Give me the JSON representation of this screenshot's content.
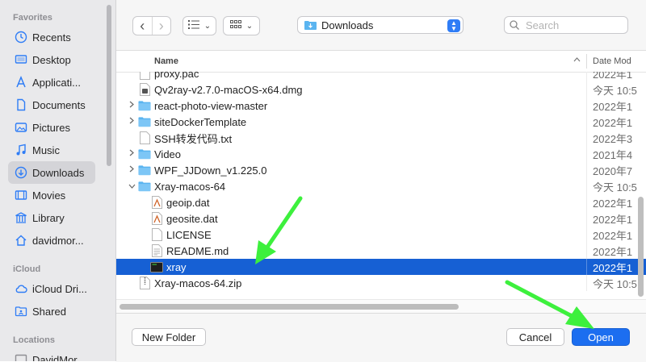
{
  "sidebar": {
    "favorites_label": "Favorites",
    "favorites": [
      {
        "label": "Recents",
        "icon": "clock-icon"
      },
      {
        "label": "Desktop",
        "icon": "desktop-icon"
      },
      {
        "label": "Applicati...",
        "icon": "applications-icon"
      },
      {
        "label": "Documents",
        "icon": "document-icon"
      },
      {
        "label": "Pictures",
        "icon": "photo-icon"
      },
      {
        "label": "Music",
        "icon": "music-note-icon"
      },
      {
        "label": "Downloads",
        "icon": "download-icon",
        "active": true
      },
      {
        "label": "Movies",
        "icon": "film-icon"
      },
      {
        "label": "Library",
        "icon": "library-icon"
      },
      {
        "label": "davidmor...",
        "icon": "home-icon"
      }
    ],
    "icloud_label": "iCloud",
    "icloud": [
      {
        "label": "iCloud Dri...",
        "icon": "cloud-icon"
      },
      {
        "label": "Shared",
        "icon": "shared-folder-icon"
      }
    ],
    "locations_label": "Locations",
    "locations": [
      {
        "label": "DavidMor...",
        "icon": "computer-icon"
      }
    ]
  },
  "toolbar": {
    "back_glyph": "‹",
    "forward_glyph": "›",
    "location": "Downloads",
    "search_placeholder": "Search"
  },
  "columns": {
    "name": "Name",
    "date": "Date Mod"
  },
  "files": [
    {
      "name": "proxy.pac",
      "date": "2022年1",
      "type": "file"
    },
    {
      "name": "Qv2ray-v2.7.0-macOS-x64.dmg",
      "date": "今天 10:5",
      "type": "dmg"
    },
    {
      "name": "react-photo-view-master",
      "date": "2022年1",
      "type": "folder",
      "collapsed": true
    },
    {
      "name": "siteDockerTemplate",
      "date": "2022年1",
      "type": "folder",
      "collapsed": true
    },
    {
      "name": "SSH转发代码.txt",
      "date": "2022年3",
      "type": "file"
    },
    {
      "name": "Video",
      "date": "2021年4",
      "type": "folder",
      "collapsed": true
    },
    {
      "name": "WPF_JJDown_v1.225.0",
      "date": "2020年7",
      "type": "folder",
      "collapsed": true
    },
    {
      "name": "Xray-macos-64",
      "date": "今天 10:5",
      "type": "folder",
      "expanded": true
    },
    {
      "name": "geoip.dat",
      "date": "2022年1",
      "type": "data",
      "child": true
    },
    {
      "name": "geosite.dat",
      "date": "2022年1",
      "type": "data",
      "child": true
    },
    {
      "name": "LICENSE",
      "date": "2022年1",
      "type": "file",
      "child": true
    },
    {
      "name": "README.md",
      "date": "2022年1",
      "type": "text",
      "child": true
    },
    {
      "name": "xray",
      "date": "2022年1",
      "type": "exec",
      "child": true,
      "selected": true
    },
    {
      "name": "Xray-macos-64.zip",
      "date": "今天 10:5",
      "type": "zip"
    }
  ],
  "buttons": {
    "new_folder": "New Folder",
    "cancel": "Cancel",
    "open": "Open"
  },
  "colors": {
    "selection": "#1660d4",
    "primary_button": "#1c6ef0",
    "arrow": "#3df03d",
    "folder": "#5ab4f0"
  }
}
